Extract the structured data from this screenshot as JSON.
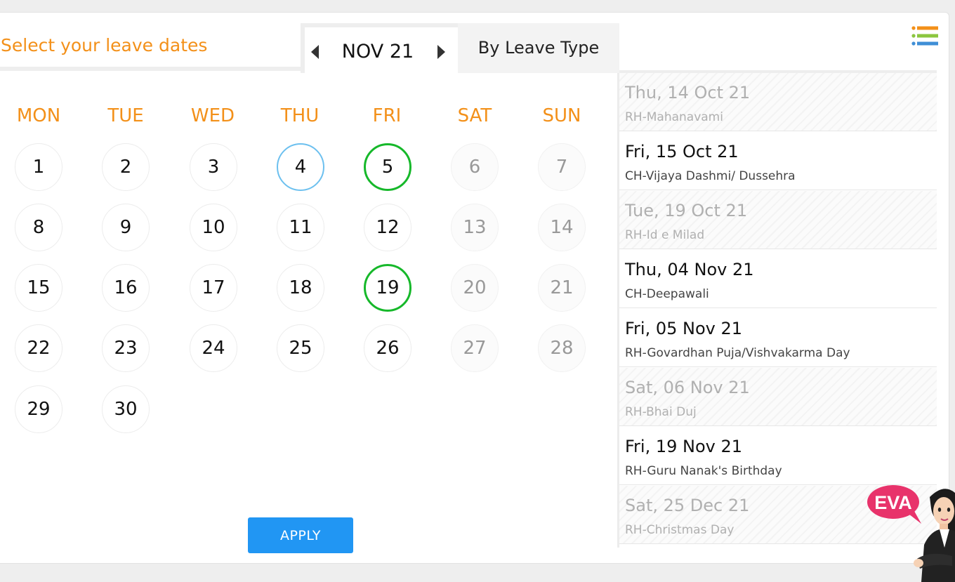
{
  "header": {
    "title": "Select your leave dates",
    "month": "NOV 21",
    "leave_type_tab": "By Leave Type",
    "list_icon": "list-icon"
  },
  "calendar": {
    "weekdays": [
      "MON",
      "TUE",
      "WED",
      "THU",
      "FRI",
      "SAT",
      "SUN"
    ],
    "weeks": [
      [
        "1",
        "2",
        "3",
        "4",
        "5",
        "6",
        "7"
      ],
      [
        "8",
        "9",
        "10",
        "11",
        "12",
        "13",
        "14"
      ],
      [
        "15",
        "16",
        "17",
        "18",
        "19",
        "20",
        "21"
      ],
      [
        "22",
        "23",
        "24",
        "25",
        "26",
        "27",
        "28"
      ],
      [
        "29",
        "30"
      ]
    ],
    "today": "4",
    "holidays": [
      "5",
      "19"
    ]
  },
  "apply_label": "APPLY",
  "holiday_list": [
    {
      "date": "Thu, 14 Oct 21",
      "name": "RH-Mahanavami",
      "past": true
    },
    {
      "date": "Fri, 15 Oct 21",
      "name": "CH-Vijaya Dashmi/ Dussehra",
      "past": false
    },
    {
      "date": "Tue, 19 Oct 21",
      "name": "RH-Id e Milad",
      "past": true
    },
    {
      "date": "Thu, 04 Nov 21",
      "name": "CH-Deepawali",
      "past": false
    },
    {
      "date": "Fri, 05 Nov 21",
      "name": "RH-Govardhan Puja/Vishvakarma Day",
      "past": false
    },
    {
      "date": "Sat, 06 Nov 21",
      "name": "RH-Bhai Duj",
      "past": true
    },
    {
      "date": "Fri, 19 Nov 21",
      "name": "RH-Guru Nanak's Birthday",
      "past": false
    },
    {
      "date": "Sat, 25 Dec 21",
      "name": "RH-Christmas Day",
      "past": true
    }
  ],
  "assistant": {
    "label": "EVA",
    "badge_color": "#e8336b"
  },
  "colors": {
    "accent_orange": "#f39019",
    "apply_blue": "#2196f3",
    "today_ring": "#6cc0ef",
    "holiday_ring": "#16b82a"
  }
}
